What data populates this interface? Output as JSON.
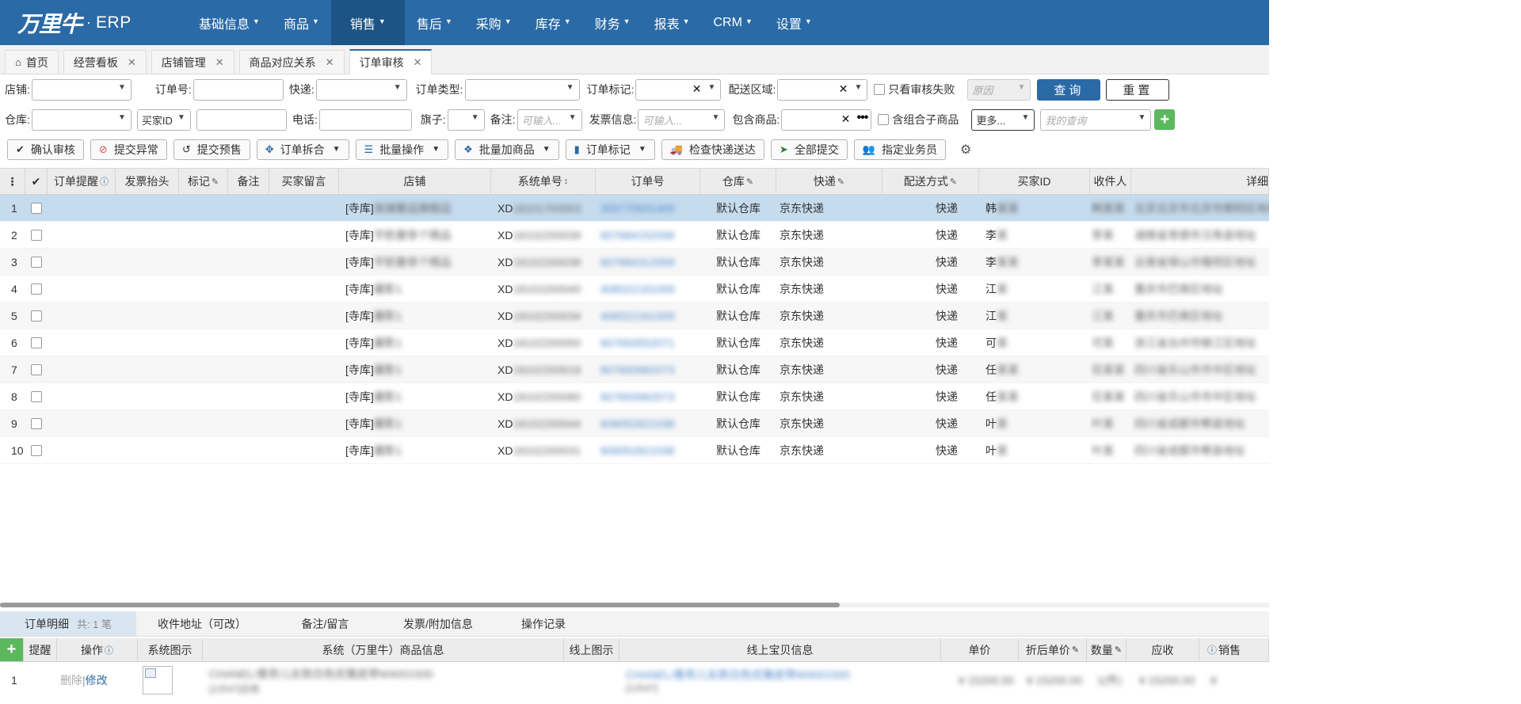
{
  "app": {
    "logo_mark": "万里牛",
    "logo_dot": "·",
    "logo_text": "ERP"
  },
  "nav": [
    {
      "label": "基础信息"
    },
    {
      "label": "商品"
    },
    {
      "label": "销售",
      "active": true
    },
    {
      "label": "售后"
    },
    {
      "label": "采购"
    },
    {
      "label": "库存"
    },
    {
      "label": "财务"
    },
    {
      "label": "报表"
    },
    {
      "label": "CRM"
    },
    {
      "label": "设置"
    }
  ],
  "tabs": [
    {
      "label": "首页"
    },
    {
      "label": "经营看板"
    },
    {
      "label": "店铺管理"
    },
    {
      "label": "商品对应关系"
    },
    {
      "label": "订单审核",
      "active": true
    }
  ],
  "filters": {
    "row1": {
      "shop": "店铺:",
      "order_no": "订单号:",
      "express": "快递:",
      "order_type": "订单类型:",
      "order_mark": "订单标记:",
      "delivery_area": "配送区域:",
      "only_failed": "只看审核失败",
      "reason_placeholder": "原因",
      "search": "查询",
      "reset": "重置"
    },
    "row2": {
      "warehouse": "仓库:",
      "buyer_id_select": "买家ID",
      "phone": "电话:",
      "flag": "旗子:",
      "remark": "备注:",
      "remark_placeholder": "可输入...",
      "invoice": "发票信息:",
      "invoice_placeholder": "可输入...",
      "contains_goods": "包含商品:",
      "contains_combo": "含组合子商品",
      "more": "更多...",
      "my_query_placeholder": "我的查询"
    }
  },
  "toolbar": [
    {
      "label": "确认审核",
      "icon": "check-icon"
    },
    {
      "label": "提交异常",
      "icon": "ban-icon"
    },
    {
      "label": "提交预售",
      "icon": "undo-icon"
    },
    {
      "label": "订单拆合",
      "icon": "move-icon",
      "dropdown": true
    },
    {
      "label": "批量操作",
      "icon": "list-icon",
      "dropdown": true
    },
    {
      "label": "批量加商品",
      "icon": "cubes-icon",
      "dropdown": true
    },
    {
      "label": "订单标记",
      "icon": "bookmark-icon",
      "dropdown": true
    },
    {
      "label": "检查快递送达",
      "icon": "truck-icon"
    },
    {
      "label": "全部提交",
      "icon": "send-icon"
    },
    {
      "label": "指定业务员",
      "icon": "users-icon"
    }
  ],
  "grid": {
    "columns": [
      "",
      "✔",
      "订单提醒",
      "发票抬头",
      "标记",
      "备注",
      "买家留言",
      "店铺",
      "系统单号",
      "订单号",
      "仓库",
      "快递",
      "配送方式",
      "买家ID",
      "收件人",
      "详细"
    ],
    "rows": [
      {
        "n": "1",
        "shop_prefix": "[寺库]",
        "shop_hidden": "高端奢品旗舰店",
        "sys_prefix": "XD",
        "sys_hidden": "18101700003",
        "order_no": "355770631400",
        "warehouse": "默认仓库",
        "express": "京东快递",
        "method": "快递",
        "buyer_first": "韩",
        "buyer_hidden": "某某",
        "receiver": "韩某某",
        "address": "北京北京市北京市朝阳区地址"
      },
      {
        "n": "2",
        "shop_prefix": "[寺库]",
        "shop_hidden": "宇航奢侈个精品",
        "sys_prefix": "XD",
        "sys_hidden": "18102200039",
        "order_no": "607684152058",
        "warehouse": "默认仓库",
        "express": "京东快递",
        "method": "快递",
        "buyer_first": "李",
        "buyer_hidden": "某",
        "receiver": "李某",
        "address": "湖南省常德市汉寿县地址"
      },
      {
        "n": "3",
        "shop_prefix": "[寺库]",
        "shop_hidden": "宇航奢侈个精品",
        "sys_prefix": "XD",
        "sys_hidden": "18102200038",
        "order_no": "607684312059",
        "warehouse": "默认仓库",
        "express": "京东快递",
        "method": "快递",
        "buyer_first": "李",
        "buyer_hidden": "某某",
        "receiver": "李某某",
        "address": "云南省保山市隆阳区地址"
      },
      {
        "n": "4",
        "shop_prefix": "[寺库]",
        "shop_hidden": "麗影1",
        "sys_prefix": "XD",
        "sys_hidden": "18102200040",
        "order_no": "406522161009",
        "warehouse": "默认仓库",
        "express": "京东快递",
        "method": "快递",
        "buyer_first": "江",
        "buyer_hidden": "某",
        "receiver": "江某",
        "address": "重庆市巴南区地址"
      },
      {
        "n": "5",
        "shop_prefix": "[寺库]",
        "shop_hidden": "麗影1",
        "sys_prefix": "XD",
        "sys_hidden": "18102200034",
        "order_no": "406522161009",
        "warehouse": "默认仓库",
        "express": "京东快递",
        "method": "快递",
        "buyer_first": "江",
        "buyer_hidden": "某",
        "receiver": "江某",
        "address": "重庆市巴南区地址"
      },
      {
        "n": "6",
        "shop_prefix": "[寺库]",
        "shop_hidden": "麗影1",
        "sys_prefix": "XD",
        "sys_hidden": "18102200050",
        "order_no": "607693552071",
        "warehouse": "默认仓库",
        "express": "京东快递",
        "method": "快递",
        "buyer_first": "可",
        "buyer_hidden": "某",
        "receiver": "可某",
        "address": "浙江省台州市椒江区地址"
      },
      {
        "n": "7",
        "shop_prefix": "[寺库]",
        "shop_hidden": "麗影1",
        "sys_prefix": "XD",
        "sys_hidden": "18102200018",
        "order_no": "607693962073",
        "warehouse": "默认仓库",
        "express": "京东快递",
        "method": "快递",
        "buyer_first": "任",
        "buyer_hidden": "某某",
        "receiver": "任某某",
        "address": "四川省乐山市市中区地址"
      },
      {
        "n": "8",
        "shop_prefix": "[寺库]",
        "shop_hidden": "麗影1",
        "sys_prefix": "XD",
        "sys_hidden": "18102200060",
        "order_no": "607693962073",
        "warehouse": "默认仓库",
        "express": "京东快递",
        "method": "快递",
        "buyer_first": "任",
        "buyer_hidden": "某某",
        "receiver": "任某某",
        "address": "四川省乐山市市中区地址"
      },
      {
        "n": "9",
        "shop_prefix": "[寺库]",
        "shop_hidden": "麗影1",
        "sys_prefix": "XD",
        "sys_hidden": "18102200044",
        "order_no": "606052821038",
        "warehouse": "默认仓库",
        "express": "京东快递",
        "method": "快递",
        "buyer_first": "叶",
        "buyer_hidden": "某",
        "receiver": "叶某",
        "address": "四川省成都市郫县地址"
      },
      {
        "n": "10",
        "shop_prefix": "[寺库]",
        "shop_hidden": "麗影1",
        "sys_prefix": "XD",
        "sys_hidden": "18102200031",
        "order_no": "606052821038",
        "warehouse": "默认仓库",
        "express": "京东快递",
        "method": "快递",
        "buyer_first": "叶",
        "buyer_hidden": "某",
        "receiver": "叶某",
        "address": "四川省成都市郫县地址"
      }
    ]
  },
  "bottom_tabs": [
    {
      "label": "订单明细",
      "count": "共: 1 笔",
      "active": true
    },
    {
      "label": "收件地址（可改）"
    },
    {
      "label": "备注/留言"
    },
    {
      "label": "发票/附加信息"
    },
    {
      "label": "操作记录"
    }
  ],
  "detail": {
    "columns": [
      "+",
      "提醒",
      "操作",
      "系统图示",
      "系统（万里牛）商品信息",
      "线上图示",
      "线上宝贝信息",
      "单价",
      "折后单价",
      "数量",
      "应收",
      "销售"
    ],
    "row": {
      "n": "1",
      "delete": "删除",
      "edit": "修改",
      "sys_info": "CHANEL/香奈儿女款白色优雅皮带W4001500",
      "sys_sub": "[12547]白色",
      "online_info": "CHANEL/香奈儿女款白色优雅皮带W4001500",
      "online_sub": "[12547]",
      "price": "¥ 15200.00",
      "disc_price": "¥ 15200.00",
      "qty": "1(件)",
      "receivable": "¥ 15200.00",
      "sales": "¥"
    }
  },
  "colors": {
    "nav_bg": "#2a6aa6",
    "nav_active": "#1d5486",
    "selected_row": "#c5dbee",
    "green": "#5cb85c"
  }
}
